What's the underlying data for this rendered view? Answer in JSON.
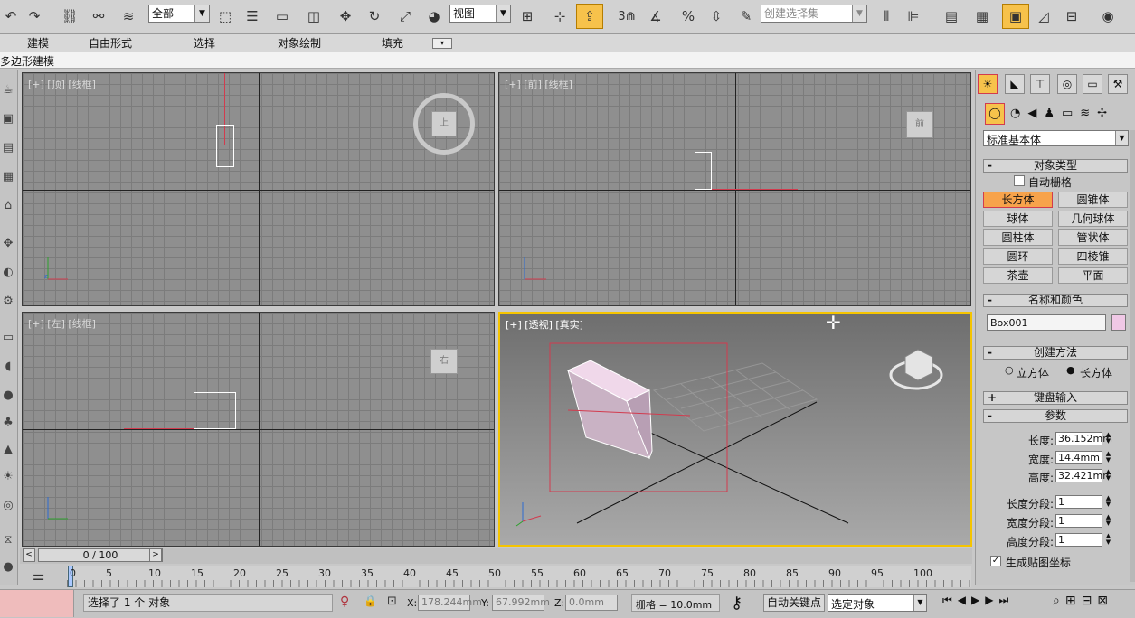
{
  "toolbar": {
    "filter": "全部",
    "coord": "视图",
    "snap_num": "3",
    "selection_set": "创建选择集"
  },
  "ribbon": {
    "tabs": [
      "建模",
      "自由形式",
      "选择",
      "对象绘制",
      "填充"
    ]
  },
  "subribbon": {
    "label": "多边形建模"
  },
  "viewports": {
    "top": {
      "label": "[+] [顶] [线框]"
    },
    "front": {
      "label": "[+] [前] [线框]"
    },
    "left": {
      "label": "[+] [左] [线框]"
    },
    "persp": {
      "label": "[+] [透视] [真实]"
    }
  },
  "viewcube": {
    "top": "上",
    "front": "前",
    "left": "右"
  },
  "timeline": {
    "position": "0 / 100",
    "ticks": [
      "0",
      "5",
      "10",
      "15",
      "20",
      "25",
      "30",
      "35",
      "40",
      "45",
      "50",
      "55",
      "60",
      "65",
      "70",
      "75",
      "80",
      "85",
      "90",
      "95",
      "100"
    ]
  },
  "status": {
    "message": "选择了 1 个 对象",
    "x_label": "X:",
    "x": "178.244mm",
    "y_label": "Y:",
    "y": "67.992mm",
    "z_label": "Z:",
    "z": "0.0mm",
    "grid": "栅格 = 10.0mm",
    "autokey": "自动关键点",
    "key_mode": "选定对象"
  },
  "cmdpanel": {
    "category": "标准基本体",
    "object_type_title": "对象类型",
    "autogrid": "自动栅格",
    "buttons": [
      "长方体",
      "圆锥体",
      "球体",
      "几何球体",
      "圆柱体",
      "管状体",
      "圆环",
      "四棱锥",
      "茶壶",
      "平面"
    ],
    "name_color_title": "名称和颜色",
    "object_name": "Box001",
    "object_color": "#f0c8e6",
    "creation_title": "创建方法",
    "creation_options": [
      "立方体",
      "长方体"
    ],
    "keyboard_title": "键盘输入",
    "params_title": "参数",
    "params": [
      {
        "label": "长度:",
        "value": "36.152mm"
      },
      {
        "label": "宽度:",
        "value": "14.4mm"
      },
      {
        "label": "高度:",
        "value": "32.421mm"
      }
    ],
    "segments": [
      {
        "label": "长度分段:",
        "value": "1"
      },
      {
        "label": "宽度分段:",
        "value": "1"
      },
      {
        "label": "高度分段:",
        "value": "1"
      }
    ],
    "gen_mapping": "生成贴图坐标"
  },
  "colors": {
    "accent": "#f5c400",
    "active_btn": "#f7a34b",
    "axis_red": "#d23b4e"
  }
}
